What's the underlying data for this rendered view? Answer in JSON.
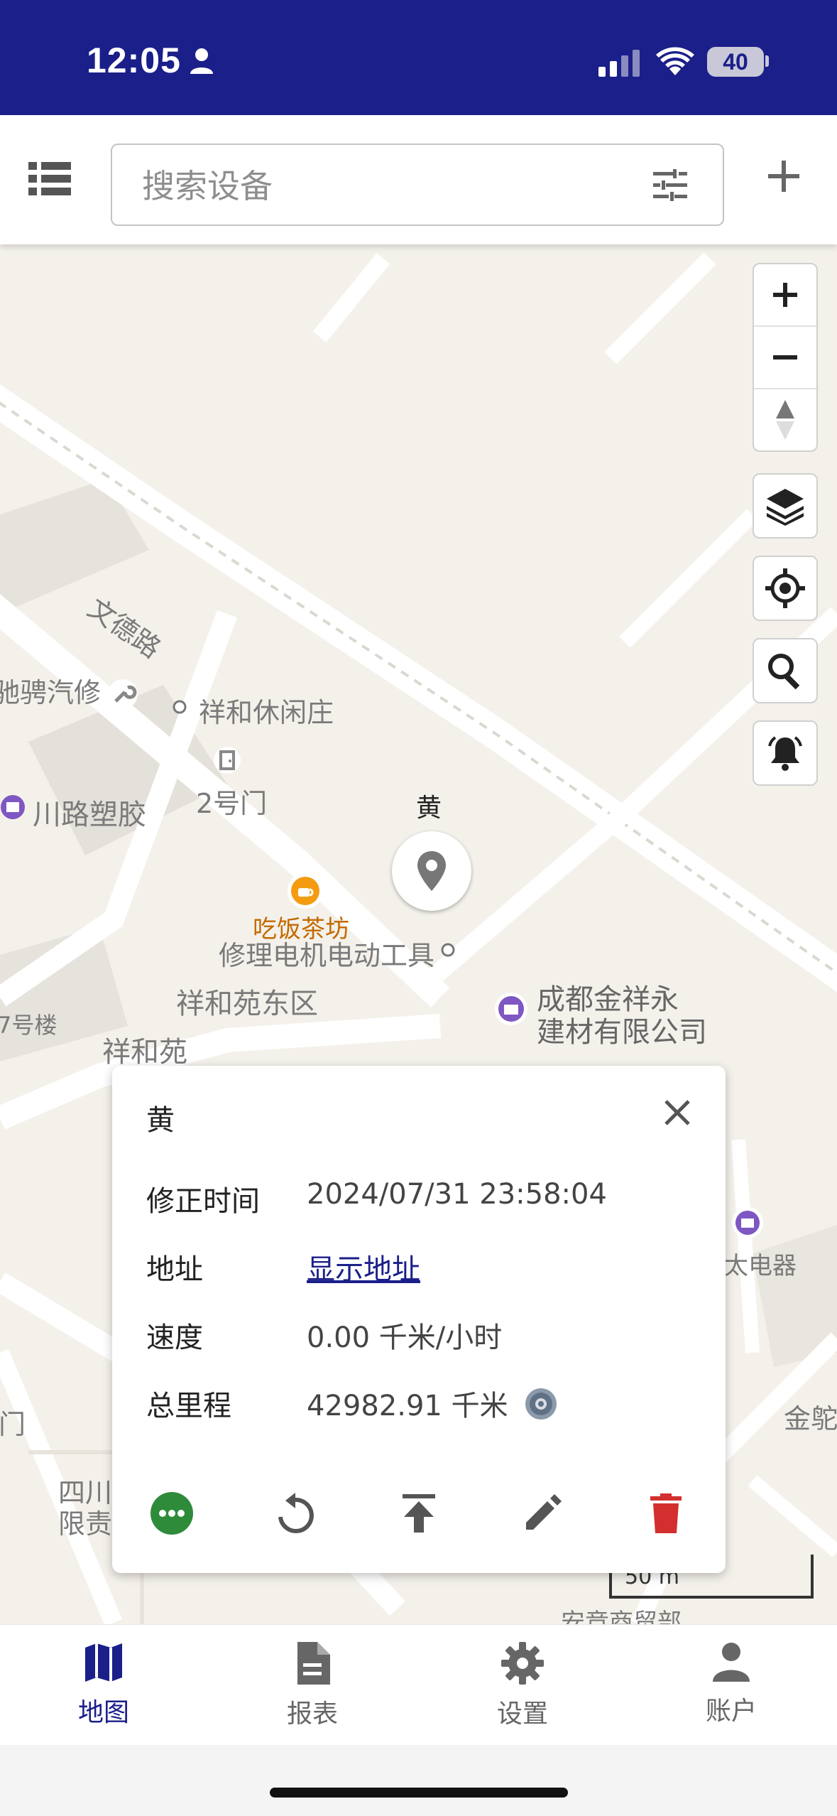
{
  "status_bar": {
    "time": "12:05",
    "battery": "40"
  },
  "search": {
    "placeholder": "搜索设备",
    "value": ""
  },
  "map": {
    "labels": {
      "wende_road": "文德路",
      "auto_repair": "驰骋汽修",
      "xianghe_villa": "祥和休闲庄",
      "gate2": "2号门",
      "plastic": "川路塑胶",
      "motor_repair": "修理电机电动工具",
      "xianghe_east": "祥和苑东区",
      "jinxiangyong_1": "成都金祥永",
      "jinxiangyong_2": "建材有限公司",
      "building7": "7号楼",
      "xiangheyuan": "祥和苑",
      "teahouse": "吃饭茶坊",
      "sichuan_1": "四川",
      "sichuan_2": "限责",
      "gate": "门",
      "jintuo": "金鸵",
      "taichang": "太电器",
      "anrong": "安竞商贸部"
    },
    "marker_name": "黄",
    "scale": "50 m",
    "controls": [
      "zoom-in",
      "zoom-out",
      "compass",
      "layers",
      "locate",
      "search",
      "alarm"
    ]
  },
  "card": {
    "title": "黄",
    "rows": [
      {
        "label": "修正时间",
        "value": "2024/07/31 23:58:04"
      },
      {
        "label": "地址",
        "value": "显示地址"
      },
      {
        "label": "速度",
        "value": "0.00 千米/小时"
      },
      {
        "label": "总里程",
        "value": "42982.91 千米"
      }
    ],
    "actions": [
      "more",
      "replay",
      "upload",
      "edit",
      "delete"
    ],
    "colors": {
      "more": "#2e8b3a",
      "delete": "#d32f2f"
    }
  },
  "nav": [
    {
      "label": "地图",
      "icon": "map-icon",
      "active": true
    },
    {
      "label": "报表",
      "icon": "report-icon",
      "active": false
    },
    {
      "label": "设置",
      "icon": "settings-icon",
      "active": false
    },
    {
      "label": "账户",
      "icon": "account-icon",
      "active": false
    }
  ],
  "colors": {
    "primary": "#1b1f8a"
  }
}
